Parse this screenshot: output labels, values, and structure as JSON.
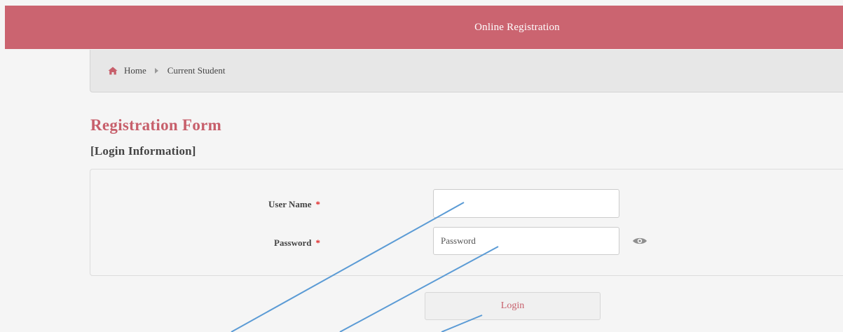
{
  "header": {
    "title": "Online Registration"
  },
  "breadcrumb": {
    "items": [
      {
        "label": "Home",
        "icon": "home-icon"
      },
      {
        "label": "Current Student"
      }
    ]
  },
  "form": {
    "title": "Registration Form",
    "section": "[Login Information]",
    "fields": {
      "username": {
        "label": "User Name",
        "required": "*",
        "value": "",
        "placeholder": ""
      },
      "password": {
        "label": "Password",
        "required": "*",
        "value": "",
        "placeholder": "Password",
        "toggle_icon": "eye-icon"
      }
    },
    "login_label": "Login"
  },
  "colors": {
    "header_bg": "#cb6470",
    "accent": "#c75f6b",
    "required": "#e02424",
    "annotation_line": "#5b9bd5"
  }
}
